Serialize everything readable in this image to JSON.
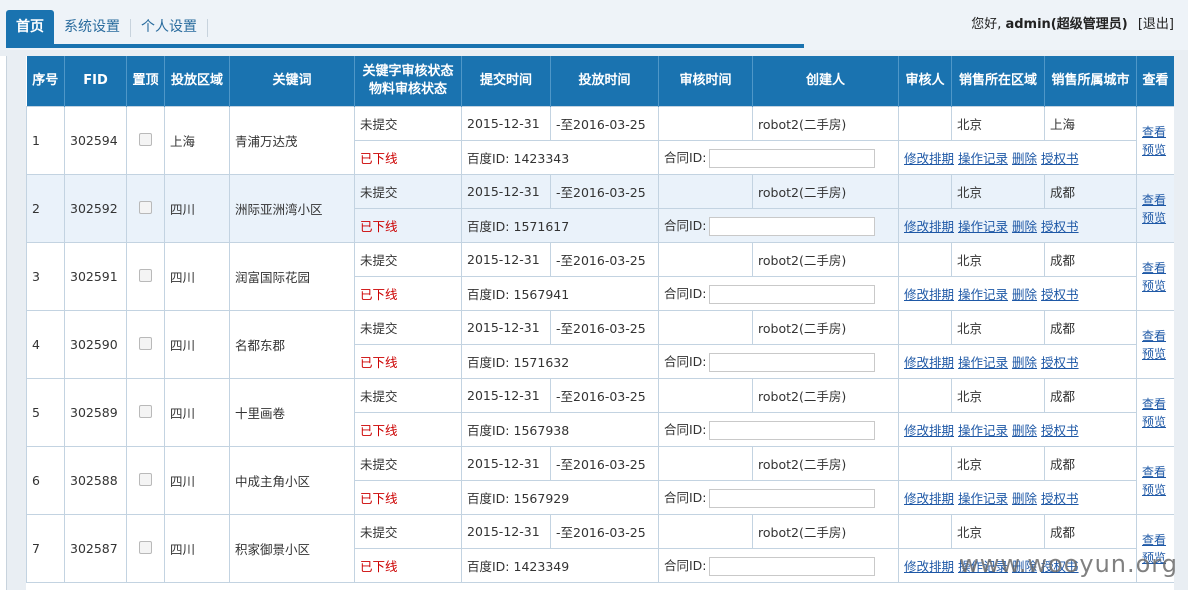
{
  "tabs": [
    {
      "label": "首页",
      "active": true
    },
    {
      "label": "系统设置",
      "active": false
    },
    {
      "label": "个人设置",
      "active": false
    }
  ],
  "user": {
    "greeting": "您好,",
    "name": "admin(超级管理员)",
    "logout_open": "[",
    "logout": "退出",
    "logout_close": "]"
  },
  "table": {
    "headers": {
      "seq": "序号",
      "fid": "FID",
      "top": "置顶",
      "region": "投放区域",
      "keyword": "关键词",
      "status1": "关键字审核状态",
      "status2": "物料审核状态",
      "submit_time": "提交时间",
      "put_time": "投放时间",
      "review_time": "审核时间",
      "creator": "创建人",
      "reviewer": "审核人",
      "sales_region": "销售所在区域",
      "sales_city": "销售所属城市",
      "view": "查看"
    },
    "labels": {
      "baidu_id": "百度ID:",
      "contract_id": "合同ID:",
      "edit_rank": "修改排期",
      "op_log": "操作记录",
      "delete": "删除",
      "auth": "授权书",
      "view": "查看",
      "preview": "预览"
    },
    "rows": [
      {
        "seq": "1",
        "fid": "302594",
        "region": "上海",
        "keyword": "青浦万达茂",
        "status": "未提交",
        "offline": "已下线",
        "submit": "2015-12-31",
        "put": "-至2016-03-25",
        "creator": "robot2(二手房)",
        "sales_region": "北京",
        "sales_city": "上海",
        "baidu_id": "1423343"
      },
      {
        "seq": "2",
        "fid": "302592",
        "region": "四川",
        "keyword": "洲际亚洲湾小区",
        "status": "未提交",
        "offline": "已下线",
        "submit": "2015-12-31",
        "put": "-至2016-03-25",
        "creator": "robot2(二手房)",
        "sales_region": "北京",
        "sales_city": "成都",
        "baidu_id": "1571617"
      },
      {
        "seq": "3",
        "fid": "302591",
        "region": "四川",
        "keyword": "润富国际花园",
        "status": "未提交",
        "offline": "已下线",
        "submit": "2015-12-31",
        "put": "-至2016-03-25",
        "creator": "robot2(二手房)",
        "sales_region": "北京",
        "sales_city": "成都",
        "baidu_id": "1567941"
      },
      {
        "seq": "4",
        "fid": "302590",
        "region": "四川",
        "keyword": "名都东郡",
        "status": "未提交",
        "offline": "已下线",
        "submit": "2015-12-31",
        "put": "-至2016-03-25",
        "creator": "robot2(二手房)",
        "sales_region": "北京",
        "sales_city": "成都",
        "baidu_id": "1571632"
      },
      {
        "seq": "5",
        "fid": "302589",
        "region": "四川",
        "keyword": "十里画卷",
        "status": "未提交",
        "offline": "已下线",
        "submit": "2015-12-31",
        "put": "-至2016-03-25",
        "creator": "robot2(二手房)",
        "sales_region": "北京",
        "sales_city": "成都",
        "baidu_id": "1567938"
      },
      {
        "seq": "6",
        "fid": "302588",
        "region": "四川",
        "keyword": "中成主角小区",
        "status": "未提交",
        "offline": "已下线",
        "submit": "2015-12-31",
        "put": "-至2016-03-25",
        "creator": "robot2(二手房)",
        "sales_region": "北京",
        "sales_city": "成都",
        "baidu_id": "1567929"
      },
      {
        "seq": "7",
        "fid": "302587",
        "region": "四川",
        "keyword": "积家御景小区",
        "status": "未提交",
        "offline": "已下线",
        "submit": "2015-12-31",
        "put": "-至2016-03-25",
        "creator": "robot2(二手房)",
        "sales_region": "北京",
        "sales_city": "成都",
        "baidu_id": "1423349"
      }
    ]
  },
  "watermark": "www.wooyun.org"
}
